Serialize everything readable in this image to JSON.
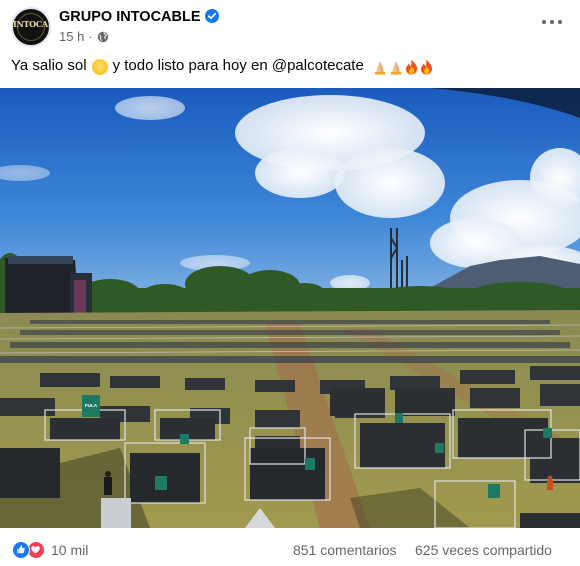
{
  "post": {
    "page_name": "GRUPO INTOCABLE",
    "avatar_text": "INTOCABLE",
    "time": "15 h",
    "separator": "·",
    "text_part1": "Ya salio sol",
    "text_part2": "y todo listo para hoy en @palcotecate",
    "icons": {
      "verified": "verified-badge-icon",
      "privacy": "globe-icon",
      "more": "more-options-icon",
      "emoji_sun": "sun-emoji",
      "emoji_hands": "folded-hands-emoji",
      "emoji_fire": "fire-emoji"
    }
  },
  "photo": {
    "banner_label": "PULA",
    "sign_labels": [
      "PULA",
      "PULA",
      "PULA"
    ]
  },
  "footer": {
    "reaction_count": "10 mil",
    "comments": "851 comentarios",
    "shares": "625 veces compartido"
  },
  "colors": {
    "facebook_blue": "#1877f2",
    "love_red": "#f33e58",
    "secondary_text": "#65676b"
  }
}
